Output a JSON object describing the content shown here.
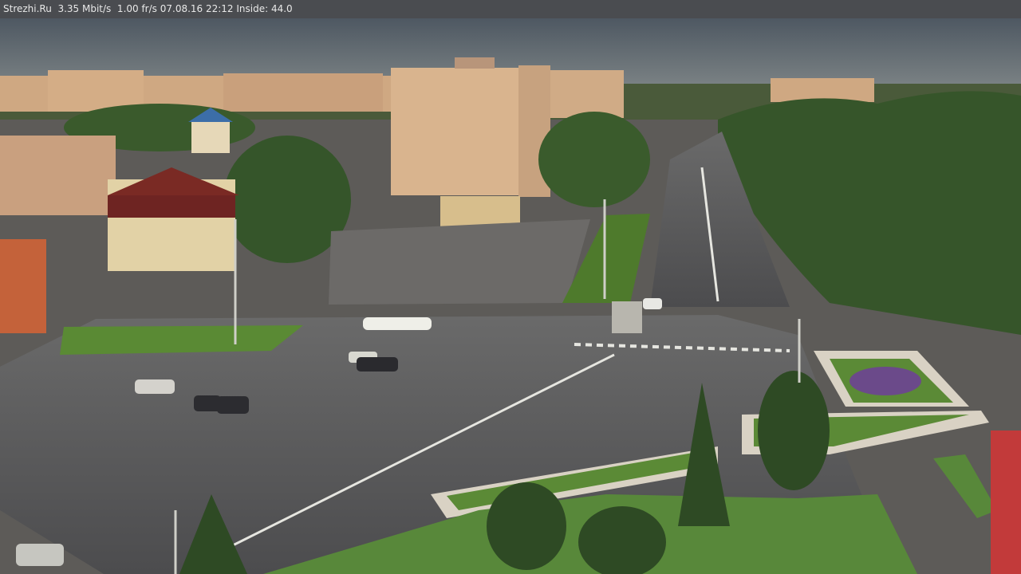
{
  "overlay": {
    "caption": "Strezhi.Ru  3.35 Mbit/s  1.00 fr/s 07.08.16 22:12 Inside: 44.0"
  },
  "colors": {
    "sky": "#5e6a73",
    "building": "#d8b48a",
    "trees": "#3a5a2a",
    "road": "#5a5a5c",
    "lawn": "#5f8a3c"
  }
}
